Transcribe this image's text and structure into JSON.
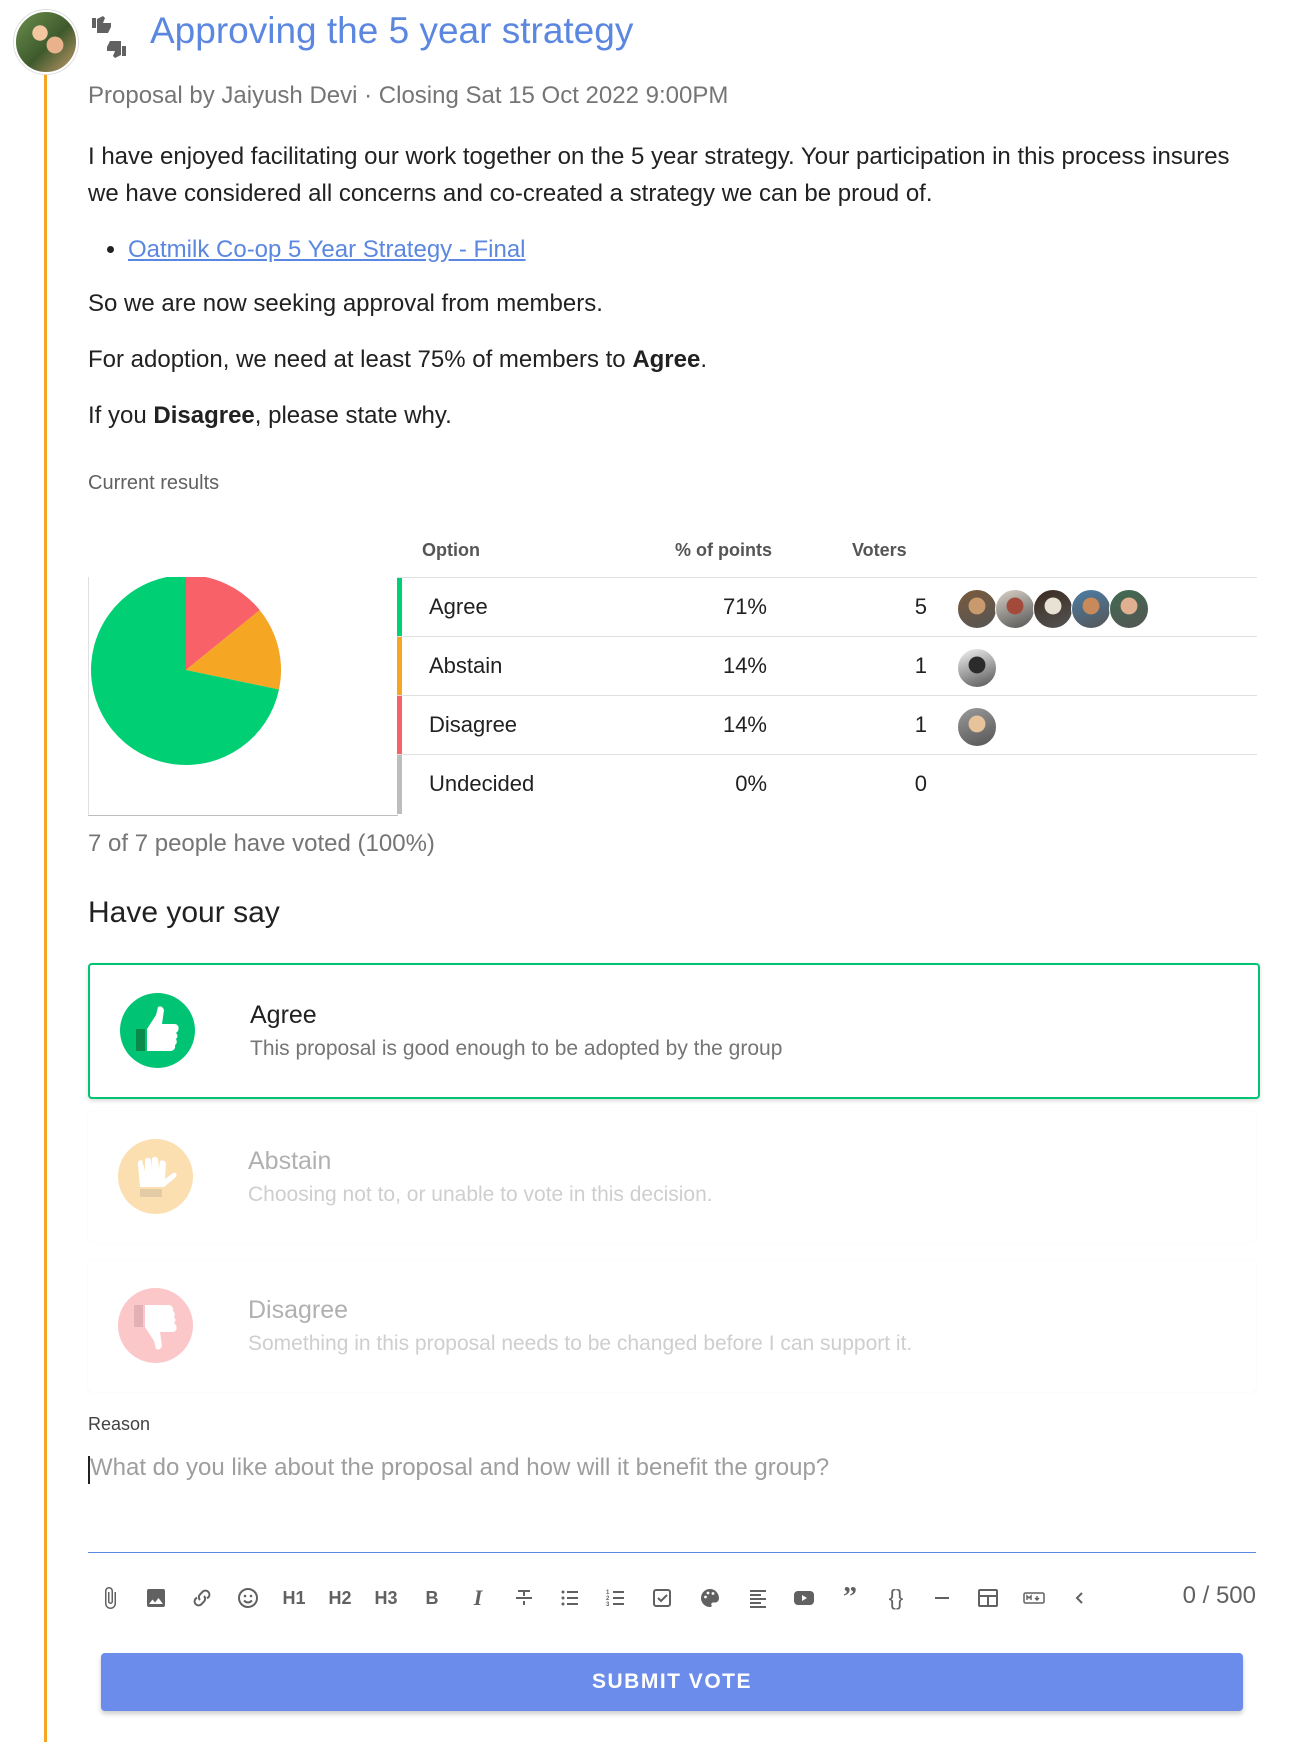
{
  "header": {
    "title": "Approving the 5 year strategy",
    "subtitle": "Proposal by Jaiyush Devi · Closing Sat 15 Oct 2022 9:00PM"
  },
  "body": {
    "intro": "I have enjoyed facilitating our work together on the 5 year strategy. Your participation in this process insures we have considered all concerns and co-created a strategy we can be proud of.",
    "link_text": "Oatmilk Co-op 5 Year Strategy - Final",
    "para2": "So we are now seeking approval from members.",
    "para3_prefix": "For adoption, we need at least 75% of members to ",
    "para3_bold": "Agree",
    "para3_suffix": ".",
    "para4_prefix": "If you ",
    "para4_bold": "Disagree",
    "para4_suffix": ", please state why."
  },
  "results": {
    "label": "Current results",
    "columns": {
      "option": "Option",
      "points": "% of points",
      "voters": "Voters"
    },
    "rows": [
      {
        "option": "Agree",
        "percent": "71%",
        "count": "5",
        "color": "#00d073",
        "avatars": 5
      },
      {
        "option": "Abstain",
        "percent": "14%",
        "count": "1",
        "color": "#f5a623",
        "avatars": 1
      },
      {
        "option": "Disagree",
        "percent": "14%",
        "count": "1",
        "color": "#f96168",
        "avatars": 1
      },
      {
        "option": "Undecided",
        "percent": "0%",
        "count": "0",
        "color": "#bdbdbd",
        "avatars": 0
      }
    ],
    "voted_text": "7 of 7 people have voted (100%)"
  },
  "chart_data": {
    "type": "pie",
    "categories": [
      "Agree",
      "Abstain",
      "Disagree",
      "Undecided"
    ],
    "values": [
      71,
      14,
      14,
      0
    ],
    "colors": [
      "#00d073",
      "#f5a623",
      "#f96168",
      "#bdbdbd"
    ]
  },
  "vote": {
    "heading": "Have your say",
    "options": [
      {
        "label": "Agree",
        "desc": "This proposal is good enough to be adopted by the group",
        "icon": "thumbs-up-icon",
        "color": "#00c473"
      },
      {
        "label": "Abstain",
        "desc": "Choosing not to, or unable to vote in this decision.",
        "icon": "thumbs-sideways-icon",
        "color": "#f5a623"
      },
      {
        "label": "Disagree",
        "desc": "Something in this proposal needs to be changed before I can support it.",
        "icon": "thumbs-down-icon",
        "color": "#f96168"
      }
    ],
    "selected": "Agree"
  },
  "reason": {
    "label": "Reason",
    "placeholder": "What do you like about the proposal and how will it benefit the group?",
    "char_count": "0 / 500"
  },
  "toolbar": {
    "h1": "H1",
    "h2": "H2",
    "h3": "H3",
    "bold": "B",
    "italic": "I",
    "quote": "”",
    "code": "{}"
  },
  "submit_label": "SUBMIT VOTE"
}
